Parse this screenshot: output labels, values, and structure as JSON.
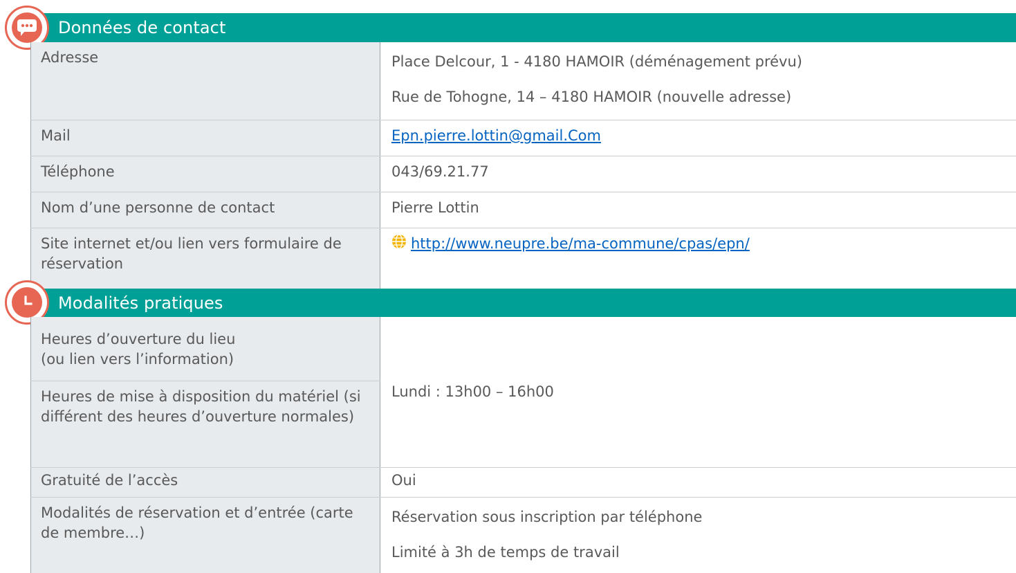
{
  "sections": [
    {
      "title": "Données de contact",
      "icon": "speech-bubble-icon",
      "rows": [
        {
          "label": "Adresse",
          "values": [
            "Place Delcour, 1 - 4180 HAMOIR (déménagement prévu)",
            "Rue de Tohogne, 14 – 4180 HAMOIR (nouvelle adresse)"
          ]
        },
        {
          "label": "Mail",
          "link": "Epn.pierre.lottin@gmail.Com"
        },
        {
          "label": "Téléphone",
          "value": "043/69.21.77"
        },
        {
          "label": "Nom d’une personne de contact",
          "value": "Pierre Lottin"
        },
        {
          "label": "Site internet et/ou lien vers formulaire de réservation",
          "link": "http://www.neupre.be/ma-commune/cpas/epn/",
          "icon": "globe-icon"
        }
      ]
    },
    {
      "title": "Modalités pratiques",
      "icon": "clock-icon",
      "rows": [
        {
          "label": "Heures d’ouverture du lieu\n(ou lien vers l’information)"
        },
        {
          "label": "Heures de mise à disposition du matériel (si différent des heures d’ouverture normales)"
        },
        {
          "shared_value": "Lundi : 13h00 – 16h00"
        },
        {
          "label": "Gratuité de l’accès",
          "value": "Oui"
        },
        {
          "label": "Modalités de réservation et d’entrée (carte de membre…)",
          "values": [
            "Réservation sous inscription par téléphone",
            "Limité à 3h de temps de travail"
          ]
        }
      ]
    }
  ],
  "colors": {
    "header_bg": "#00A096",
    "icon_accent": "#E66553",
    "label_bg": "#E8EBEE",
    "link": "#0563C1",
    "globe": "#F5B400"
  }
}
